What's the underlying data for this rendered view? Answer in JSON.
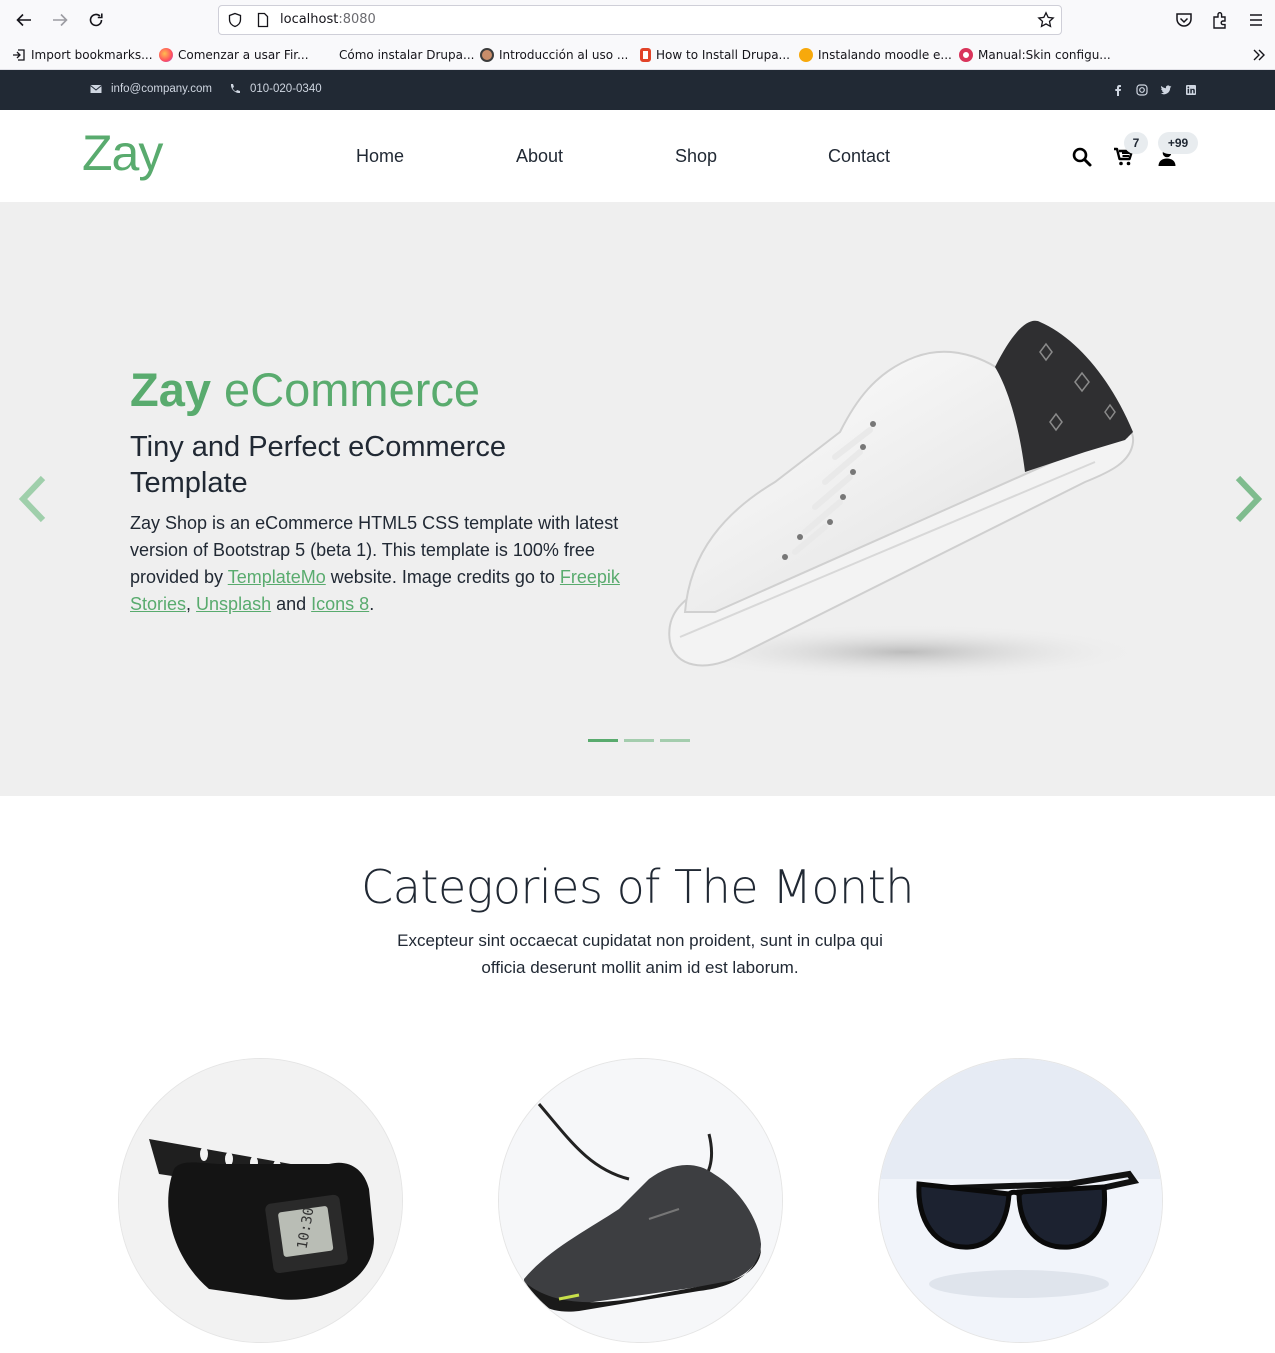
{
  "browser": {
    "url_host": "localhost",
    "url_port": ":8080",
    "bookmarks": [
      {
        "label": "Import bookmarks...",
        "icon": "import-icon"
      },
      {
        "label": "Comenzar a usar Fir...",
        "icon": "firefox-icon"
      },
      {
        "label": "Cómo instalar Drupa...",
        "icon": "drupal-icon"
      },
      {
        "label": "Introducción al uso ...",
        "icon": "avatar-icon"
      },
      {
        "label": "How to Install Drupa...",
        "icon": "page-icon"
      },
      {
        "label": "Instalando moodle e...",
        "icon": "moodle-icon"
      },
      {
        "label": "Manual:Skin configu...",
        "icon": "wiki-icon"
      }
    ]
  },
  "topbar": {
    "email": "info@company.com",
    "phone": "010-020-0340",
    "socials": [
      "facebook-icon",
      "instagram-icon",
      "twitter-icon",
      "linkedin-icon"
    ]
  },
  "header": {
    "logo": "Zay",
    "menu": [
      "Home",
      "About",
      "Shop",
      "Contact"
    ],
    "cart_count": "7",
    "user_count": "+99"
  },
  "hero": {
    "title_brand": "Zay",
    "title_rest": " eCommerce",
    "subtitle": "Tiny and Perfect eCommerce Template",
    "text_1": "Zay Shop is an eCommerce HTML5 CSS template with latest version of Bootstrap 5 (beta 1). This template is 100% free provided by ",
    "link_templatemo": "TemplateMo",
    "text_2": " website. Image credits go to ",
    "link_freepik": "Freepik Stories",
    "text_3": ", ",
    "link_unsplash": "Unsplash",
    "text_4": " and ",
    "link_icons8": "Icons 8",
    "text_5": ".",
    "active_slide": 1,
    "slide_count": 3
  },
  "categories": {
    "title": "Categories of The Month",
    "text": "Excepteur sint occaecat cupidatat non proident, sunt in culpa qui officia deserunt mollit anim id est laborum.",
    "items": [
      "watch-image",
      "sneaker-image",
      "sunglasses-image"
    ]
  },
  "colors": {
    "brand_green": "#59ab6e",
    "dark": "#212934",
    "hero_bg": "#efefef"
  }
}
